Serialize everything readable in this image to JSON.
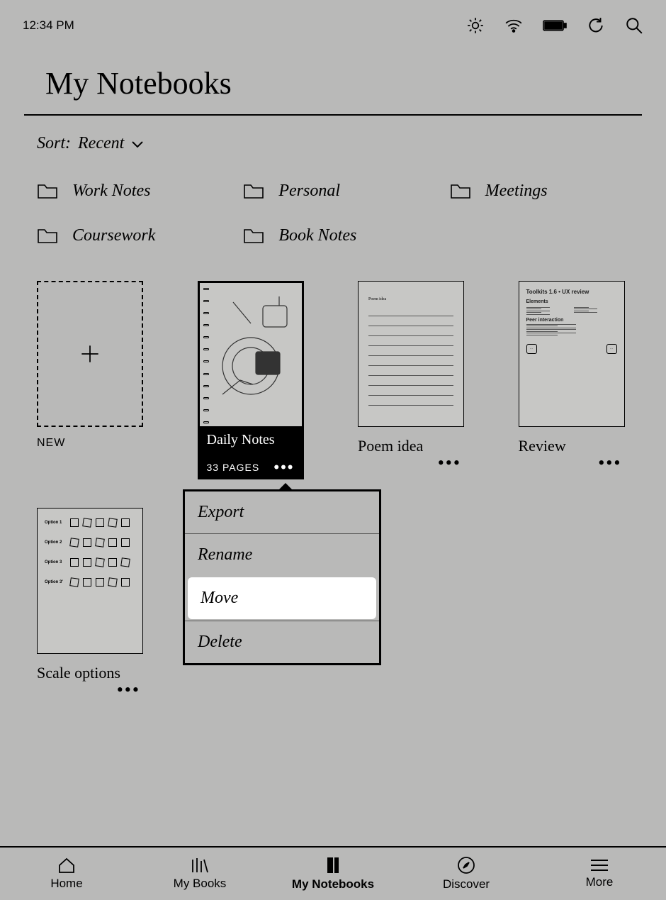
{
  "status": {
    "time": "12:34 PM"
  },
  "header": {
    "title": "My Notebooks"
  },
  "sort": {
    "prefix": "Sort:",
    "value": "Recent"
  },
  "folders": [
    {
      "label": "Work Notes"
    },
    {
      "label": "Personal"
    },
    {
      "label": "Meetings"
    },
    {
      "label": "Coursework"
    },
    {
      "label": "Book Notes"
    }
  ],
  "new_label": "NEW",
  "notebooks": {
    "daily": {
      "title": "Daily Notes",
      "pages_label": "33 PAGES"
    },
    "poem": {
      "title": "Poem idea",
      "thumb_caption": "Poem idea"
    },
    "review": {
      "title": "Review",
      "thumb_heading": "Toolkits 1.6 • UX review",
      "sec1": "Elements",
      "sec2": "Peer interaction"
    },
    "scale": {
      "title": "Scale options",
      "rows": [
        "Option 1",
        "Option 2",
        "Option 3",
        "Option 3'"
      ]
    }
  },
  "context_menu": {
    "items": [
      {
        "label": "Export"
      },
      {
        "label": "Rename"
      },
      {
        "label": "Move"
      },
      {
        "label": "Delete"
      }
    ],
    "highlighted_index": 2
  },
  "nav": {
    "items": [
      {
        "label": "Home"
      },
      {
        "label": "My Books"
      },
      {
        "label": "My Notebooks"
      },
      {
        "label": "Discover"
      },
      {
        "label": "More"
      }
    ],
    "active_index": 2
  }
}
